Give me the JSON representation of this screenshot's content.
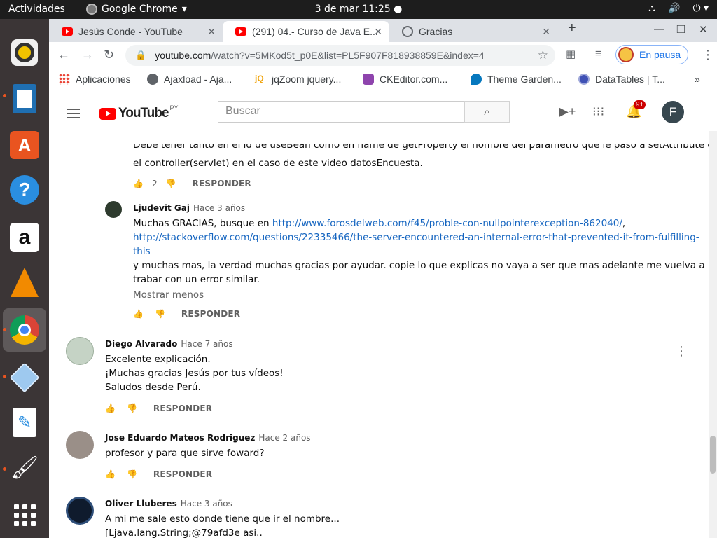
{
  "topbar": {
    "activities": "Actividades",
    "app_name": "Google Chrome",
    "clock": "3 de mar  11:25"
  },
  "dock": {
    "items": [
      "rhythmbox-icon",
      "libreoffice-writer-icon",
      "ubuntu-software-icon",
      "help-icon",
      "amazon-icon",
      "vlc-icon",
      "chrome-icon",
      "virtualbox-icon",
      "text-editor-icon",
      "kolourpaint-icon",
      "app-grid-icon"
    ]
  },
  "tabs": [
    {
      "title": "Jesús Conde - YouTube",
      "icon": "youtube-icon"
    },
    {
      "title": "(291) 04.- Curso de Java E...",
      "icon": "youtube-icon"
    },
    {
      "title": "Gracias",
      "icon": "globe-icon"
    }
  ],
  "toolbar": {
    "url_host": "youtube.com",
    "url_rest": "/watch?v=5MKod5t_p0E&list=PL5F907F818938859E&index=4",
    "pause_label": "En pausa"
  },
  "bookmarks": [
    "Aplicaciones",
    "Ajaxload - Aja...",
    "jqZoom jquery...",
    "CKEditor.com...",
    "Theme Garden...",
    "DataTables | T..."
  ],
  "yt": {
    "logo_word": "YouTube",
    "country": "PY",
    "search_placeholder": "Buscar",
    "notif_count": "9+",
    "user_initial": "F"
  },
  "comments": {
    "c0": {
      "line1": "Debe tener tanto en el id de useBean como en name de getProperty el nombre del parametro que le paso a setAttribute en",
      "line2": "el controller(servlet) en el caso de este video datosEncuesta.",
      "likes": "2",
      "reply": "RESPONDER"
    },
    "c1": {
      "author": "Ljudevit Gaj",
      "time": "Hace 3 años",
      "line1": "Muchas GRACIAS, busque en ",
      "link1": "http://www.forosdelweb.com/f45/proble-con-nullpointerexception-862040/",
      "line1_end": ",",
      "link2": "http://stackoverflow.com/questions/22335466/the-server-encountered-an-internal-error-that-prevented-it-from-fulfilling-",
      "link3": "this",
      "line3": "   y muchas mas, la verdad muchas gracias por ayudar. copie lo que explicas no vaya a ser que mas adelante me vuelva a",
      "line4": "trabar con un error similar.",
      "show_less": "Mostrar menos",
      "reply": "RESPONDER"
    },
    "c2": {
      "author": "Diego Alvarado",
      "time": "Hace 7 años",
      "line1": "Excelente explicación.",
      "line2": "¡Muchas gracias Jesús por tus vídeos!",
      "line3": "Saludos desde Perú.",
      "reply": "RESPONDER"
    },
    "c3": {
      "author": "Jose Eduardo Mateos Rodriguez",
      "time": "Hace 2 años",
      "line1": "profesor y para que sirve foward?",
      "reply": "RESPONDER"
    },
    "c4": {
      "author": "Oliver Lluberes",
      "time": "Hace 3 años",
      "line1": "A mi me sale esto donde tiene que ir el nombre...",
      "line2": "[Ljava.lang.String;@79afd3e       asi.."
    }
  }
}
